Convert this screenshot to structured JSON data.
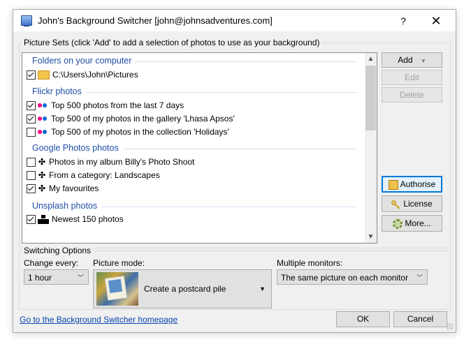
{
  "window": {
    "title": "John's Background Switcher [john@johnsadventures.com]",
    "help_label": "?",
    "close_label": "✕"
  },
  "picture_sets": {
    "legend": "Picture Sets (click 'Add' to add a selection of photos to use as your background)",
    "sections": [
      {
        "title": "Folders on your computer",
        "items": [
          {
            "label": "C:\\Users\\John\\Pictures",
            "checked": true,
            "icon": "folder-icon"
          }
        ]
      },
      {
        "title": "Flickr photos",
        "items": [
          {
            "label": "Top 500 photos from the last 7 days",
            "checked": true,
            "icon": "flickr-icon"
          },
          {
            "label": "Top 500 of my photos in the gallery 'Lhasa Apsos'",
            "checked": true,
            "icon": "flickr-icon"
          },
          {
            "label": "Top 500 of my photos in the collection 'Holidays'",
            "checked": false,
            "icon": "flickr-icon"
          }
        ]
      },
      {
        "title": "Google Photos photos",
        "items": [
          {
            "label": "Photos in my album Billy's Photo Shoot",
            "checked": false,
            "icon": "google-photos-icon"
          },
          {
            "label": "From a category: Landscapes",
            "checked": false,
            "icon": "google-photos-icon"
          },
          {
            "label": "My favourites",
            "checked": true,
            "icon": "google-photos-icon"
          }
        ]
      },
      {
        "title": "Unsplash photos",
        "items": [
          {
            "label": "Newest 150 photos",
            "checked": true,
            "icon": "unsplash-icon"
          }
        ]
      }
    ],
    "scroll_up": "▲",
    "scroll_down": "▼"
  },
  "buttons": {
    "add": "Add",
    "add_arrow": "▼",
    "edit": "Edit",
    "delete": "Delete",
    "authorise": "Authorise",
    "license": "License",
    "more": "More..."
  },
  "switching": {
    "legend": "Switching Options",
    "change_every_label": "Change every:",
    "change_every_value": "1 hour",
    "picture_mode_label": "Picture mode:",
    "picture_mode_value": "Create a postcard pile",
    "monitors_label": "Multiple monitors:",
    "monitors_value": "The same picture on each monitor"
  },
  "footer": {
    "homepage_link": "Go to the Background Switcher homepage",
    "ok": "OK",
    "cancel": "Cancel"
  },
  "colors": {
    "section_title": "#1f4ea6",
    "focus_border": "#0078d7",
    "link": "#0645ad"
  }
}
